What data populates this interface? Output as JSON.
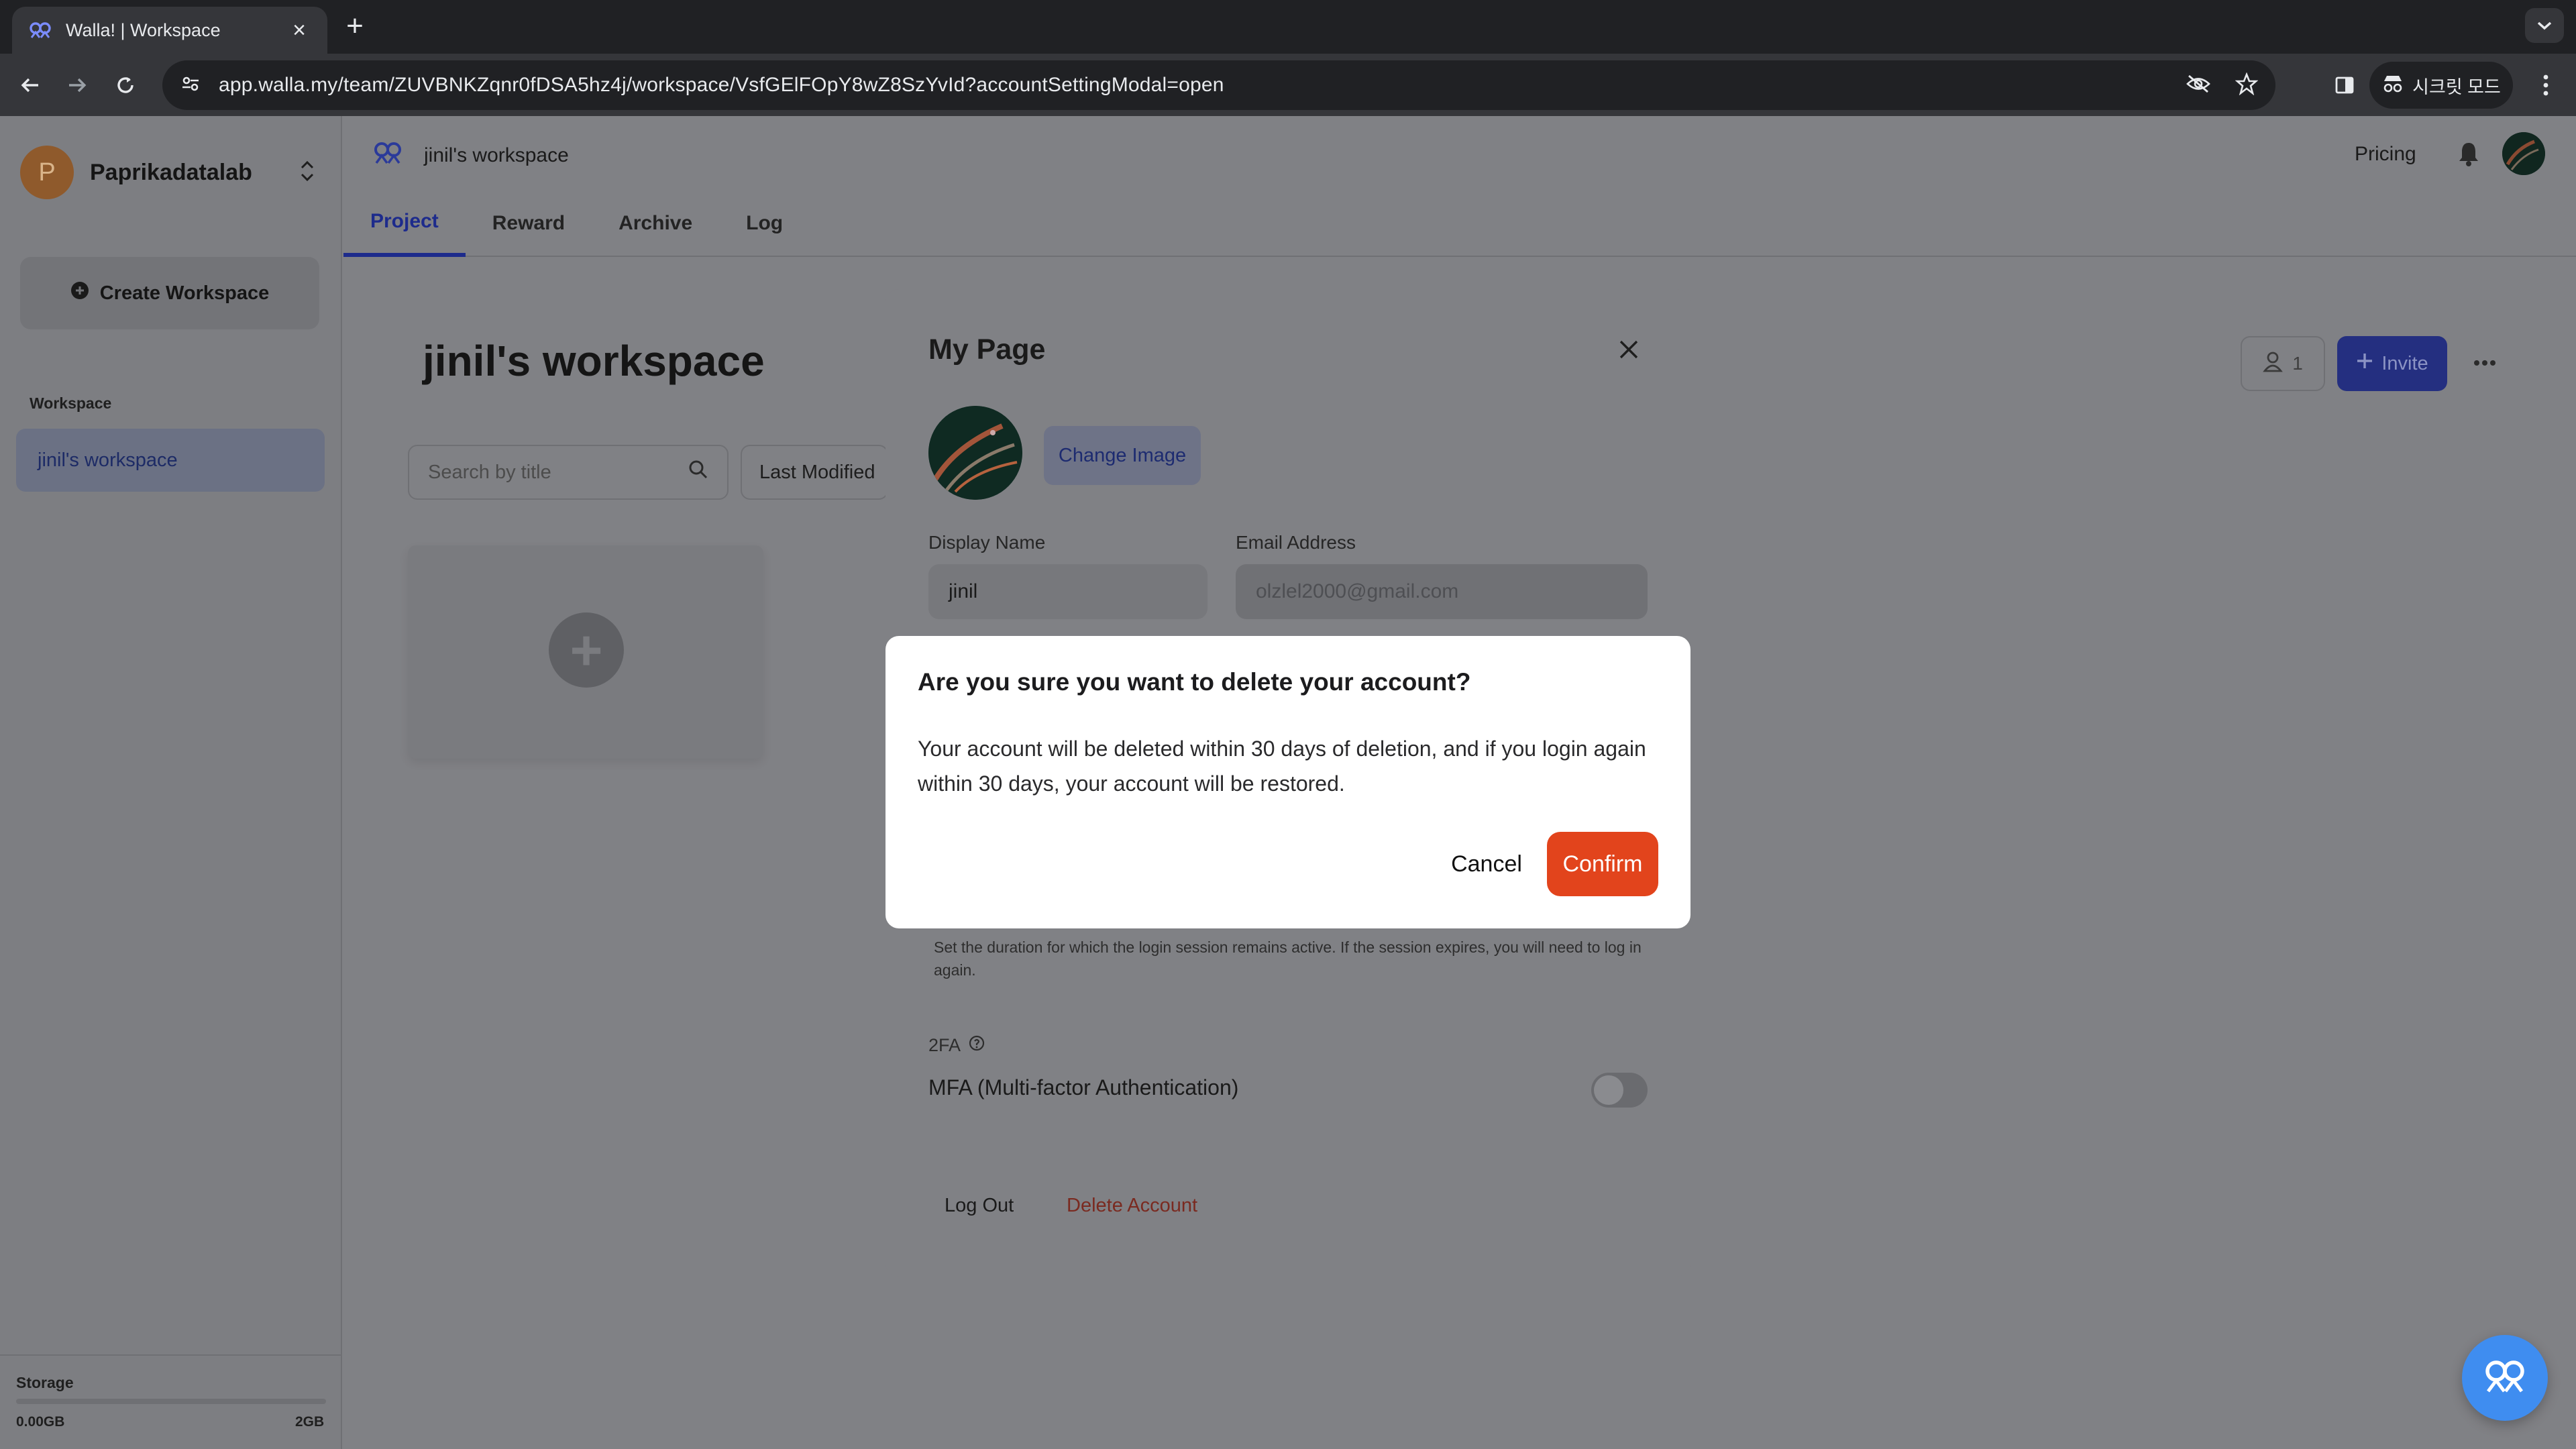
{
  "browser": {
    "tab_title": "Walla! | Workspace",
    "url": "app.walla.my/team/ZUVBNKZqnr0fDSA5hz4j/workspace/VsfGElFOpY8wZ8SzYvId?accountSettingModal=open",
    "incognito_label": "시크릿 모드"
  },
  "sidebar": {
    "team_initial": "P",
    "team_name": "Paprikadatalab",
    "create_workspace": "Create Workspace",
    "section_label": "Workspace",
    "workspaces": [
      {
        "label": "jinil's workspace",
        "selected": true
      }
    ],
    "storage": {
      "label": "Storage",
      "used": "0.00GB",
      "total": "2GB",
      "used_fraction": 0
    }
  },
  "header": {
    "breadcrumb": "jinil's workspace",
    "pricing": "Pricing",
    "tabs": [
      "Project",
      "Reward",
      "Archive",
      "Log"
    ],
    "active_tab": "Project"
  },
  "main": {
    "title": "jinil's workspace",
    "search_placeholder": "Search by title",
    "sort_label": "Last Modified",
    "member_count": "1",
    "invite_label": "Invite"
  },
  "my_page": {
    "title": "My Page",
    "change_image": "Change Image",
    "display_name_label": "Display Name",
    "display_name_value": "jinil",
    "email_label": "Email Address",
    "email_placeholder": "olzlel2000@gmail.com",
    "session_desc": "Set the duration for which the login session remains active. If the session expires, you will need to log in again.",
    "twofa_label": "2FA",
    "mfa_label": "MFA (Multi-factor Authentication)",
    "mfa_enabled": false,
    "logout": "Log Out",
    "delete_account": "Delete Account"
  },
  "confirm_dialog": {
    "title": "Are you sure you want to delete your account?",
    "body": "Your account will be deleted within 30 days of deletion, and if you login again within 30 days, your account will be restored.",
    "cancel": "Cancel",
    "confirm": "Confirm"
  },
  "colors": {
    "overlay": "#808185",
    "primary": "#2f41c2",
    "danger": "#e2441c",
    "browser_dark": "#202124",
    "browser_mid": "#35363a"
  },
  "icons": {
    "app_logo": "walla-logo-icon",
    "help": "walla-chat-icon"
  }
}
